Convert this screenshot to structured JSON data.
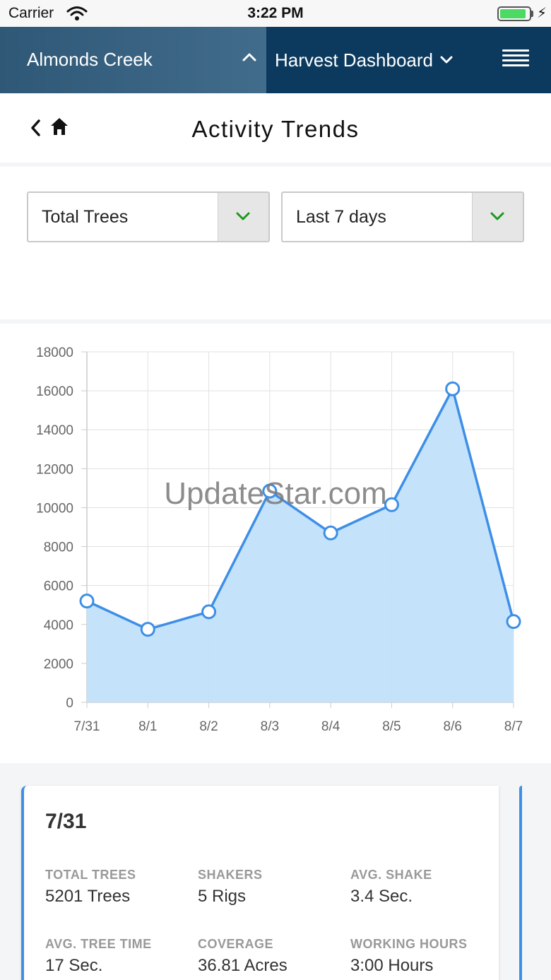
{
  "status_bar": {
    "carrier": "Carrier",
    "time": "3:22 PM",
    "battery_level": 0.9,
    "battery_color": "#4cd964"
  },
  "nav": {
    "farm_name": "Almonds Creek",
    "dashboard_label": "Harvest Dashboard",
    "menu_icon": "hamburger-icon"
  },
  "header": {
    "title": "Activity Trends",
    "back_icon": "chevron-left-icon",
    "home_icon": "home-icon"
  },
  "filters": {
    "metric": "Total Trees",
    "range": "Last 7 days",
    "chevron_color": "#1a9a1a"
  },
  "watermark": "UpdateStar.com",
  "chart_data": {
    "type": "area",
    "x": [
      "7/31",
      "8/1",
      "8/2",
      "8/3",
      "8/4",
      "8/5",
      "8/6",
      "8/7"
    ],
    "series": [
      {
        "values": [
          5201,
          3750,
          4650,
          10850,
          8700,
          10150,
          16100,
          4150
        ]
      }
    ],
    "yticks": [
      0,
      2000,
      4000,
      6000,
      8000,
      10000,
      12000,
      14000,
      16000,
      18000
    ],
    "ylim": [
      0,
      18000
    ],
    "grid": true,
    "line_color": "#3d8fe6",
    "fill_color": "#c2e0fb"
  },
  "detail": {
    "date": "7/31",
    "accent_color": "#3d8fe6",
    "stats": [
      {
        "label": "TOTAL TREES",
        "value": "5201 Trees"
      },
      {
        "label": "SHAKERS",
        "value": "5 Rigs"
      },
      {
        "label": "AVG. SHAKE",
        "value": "3.4 Sec."
      },
      {
        "label": "AVG. TREE TIME",
        "value": "17 Sec."
      },
      {
        "label": "COVERAGE",
        "value": "36.81 Acres"
      },
      {
        "label": "WORKING HOURS",
        "value": "3:00 Hours"
      }
    ]
  }
}
